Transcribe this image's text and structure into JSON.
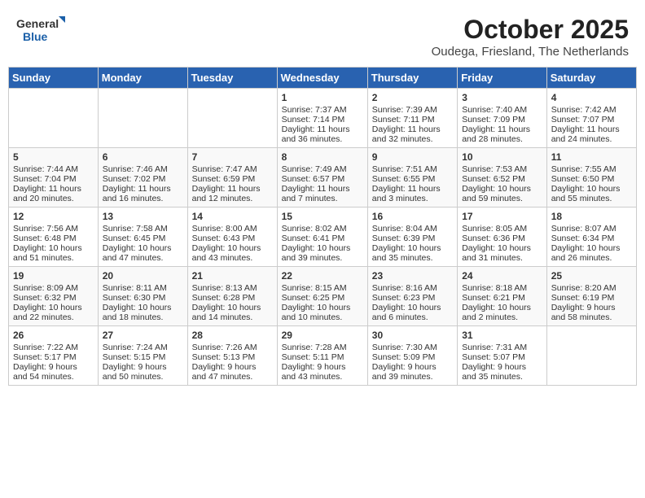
{
  "header": {
    "logo_general": "General",
    "logo_blue": "Blue",
    "title": "October 2025",
    "subtitle": "Oudega, Friesland, The Netherlands"
  },
  "weekdays": [
    "Sunday",
    "Monday",
    "Tuesday",
    "Wednesday",
    "Thursday",
    "Friday",
    "Saturday"
  ],
  "weeks": [
    [
      {
        "day": "",
        "lines": []
      },
      {
        "day": "",
        "lines": []
      },
      {
        "day": "",
        "lines": []
      },
      {
        "day": "1",
        "lines": [
          "Sunrise: 7:37 AM",
          "Sunset: 7:14 PM",
          "Daylight: 11 hours",
          "and 36 minutes."
        ]
      },
      {
        "day": "2",
        "lines": [
          "Sunrise: 7:39 AM",
          "Sunset: 7:11 PM",
          "Daylight: 11 hours",
          "and 32 minutes."
        ]
      },
      {
        "day": "3",
        "lines": [
          "Sunrise: 7:40 AM",
          "Sunset: 7:09 PM",
          "Daylight: 11 hours",
          "and 28 minutes."
        ]
      },
      {
        "day": "4",
        "lines": [
          "Sunrise: 7:42 AM",
          "Sunset: 7:07 PM",
          "Daylight: 11 hours",
          "and 24 minutes."
        ]
      }
    ],
    [
      {
        "day": "5",
        "lines": [
          "Sunrise: 7:44 AM",
          "Sunset: 7:04 PM",
          "Daylight: 11 hours",
          "and 20 minutes."
        ]
      },
      {
        "day": "6",
        "lines": [
          "Sunrise: 7:46 AM",
          "Sunset: 7:02 PM",
          "Daylight: 11 hours",
          "and 16 minutes."
        ]
      },
      {
        "day": "7",
        "lines": [
          "Sunrise: 7:47 AM",
          "Sunset: 6:59 PM",
          "Daylight: 11 hours",
          "and 12 minutes."
        ]
      },
      {
        "day": "8",
        "lines": [
          "Sunrise: 7:49 AM",
          "Sunset: 6:57 PM",
          "Daylight: 11 hours",
          "and 7 minutes."
        ]
      },
      {
        "day": "9",
        "lines": [
          "Sunrise: 7:51 AM",
          "Sunset: 6:55 PM",
          "Daylight: 11 hours",
          "and 3 minutes."
        ]
      },
      {
        "day": "10",
        "lines": [
          "Sunrise: 7:53 AM",
          "Sunset: 6:52 PM",
          "Daylight: 10 hours",
          "and 59 minutes."
        ]
      },
      {
        "day": "11",
        "lines": [
          "Sunrise: 7:55 AM",
          "Sunset: 6:50 PM",
          "Daylight: 10 hours",
          "and 55 minutes."
        ]
      }
    ],
    [
      {
        "day": "12",
        "lines": [
          "Sunrise: 7:56 AM",
          "Sunset: 6:48 PM",
          "Daylight: 10 hours",
          "and 51 minutes."
        ]
      },
      {
        "day": "13",
        "lines": [
          "Sunrise: 7:58 AM",
          "Sunset: 6:45 PM",
          "Daylight: 10 hours",
          "and 47 minutes."
        ]
      },
      {
        "day": "14",
        "lines": [
          "Sunrise: 8:00 AM",
          "Sunset: 6:43 PM",
          "Daylight: 10 hours",
          "and 43 minutes."
        ]
      },
      {
        "day": "15",
        "lines": [
          "Sunrise: 8:02 AM",
          "Sunset: 6:41 PM",
          "Daylight: 10 hours",
          "and 39 minutes."
        ]
      },
      {
        "day": "16",
        "lines": [
          "Sunrise: 8:04 AM",
          "Sunset: 6:39 PM",
          "Daylight: 10 hours",
          "and 35 minutes."
        ]
      },
      {
        "day": "17",
        "lines": [
          "Sunrise: 8:05 AM",
          "Sunset: 6:36 PM",
          "Daylight: 10 hours",
          "and 31 minutes."
        ]
      },
      {
        "day": "18",
        "lines": [
          "Sunrise: 8:07 AM",
          "Sunset: 6:34 PM",
          "Daylight: 10 hours",
          "and 26 minutes."
        ]
      }
    ],
    [
      {
        "day": "19",
        "lines": [
          "Sunrise: 8:09 AM",
          "Sunset: 6:32 PM",
          "Daylight: 10 hours",
          "and 22 minutes."
        ]
      },
      {
        "day": "20",
        "lines": [
          "Sunrise: 8:11 AM",
          "Sunset: 6:30 PM",
          "Daylight: 10 hours",
          "and 18 minutes."
        ]
      },
      {
        "day": "21",
        "lines": [
          "Sunrise: 8:13 AM",
          "Sunset: 6:28 PM",
          "Daylight: 10 hours",
          "and 14 minutes."
        ]
      },
      {
        "day": "22",
        "lines": [
          "Sunrise: 8:15 AM",
          "Sunset: 6:25 PM",
          "Daylight: 10 hours",
          "and 10 minutes."
        ]
      },
      {
        "day": "23",
        "lines": [
          "Sunrise: 8:16 AM",
          "Sunset: 6:23 PM",
          "Daylight: 10 hours",
          "and 6 minutes."
        ]
      },
      {
        "day": "24",
        "lines": [
          "Sunrise: 8:18 AM",
          "Sunset: 6:21 PM",
          "Daylight: 10 hours",
          "and 2 minutes."
        ]
      },
      {
        "day": "25",
        "lines": [
          "Sunrise: 8:20 AM",
          "Sunset: 6:19 PM",
          "Daylight: 9 hours",
          "and 58 minutes."
        ]
      }
    ],
    [
      {
        "day": "26",
        "lines": [
          "Sunrise: 7:22 AM",
          "Sunset: 5:17 PM",
          "Daylight: 9 hours",
          "and 54 minutes."
        ]
      },
      {
        "day": "27",
        "lines": [
          "Sunrise: 7:24 AM",
          "Sunset: 5:15 PM",
          "Daylight: 9 hours",
          "and 50 minutes."
        ]
      },
      {
        "day": "28",
        "lines": [
          "Sunrise: 7:26 AM",
          "Sunset: 5:13 PM",
          "Daylight: 9 hours",
          "and 47 minutes."
        ]
      },
      {
        "day": "29",
        "lines": [
          "Sunrise: 7:28 AM",
          "Sunset: 5:11 PM",
          "Daylight: 9 hours",
          "and 43 minutes."
        ]
      },
      {
        "day": "30",
        "lines": [
          "Sunrise: 7:30 AM",
          "Sunset: 5:09 PM",
          "Daylight: 9 hours",
          "and 39 minutes."
        ]
      },
      {
        "day": "31",
        "lines": [
          "Sunrise: 7:31 AM",
          "Sunset: 5:07 PM",
          "Daylight: 9 hours",
          "and 35 minutes."
        ]
      },
      {
        "day": "",
        "lines": []
      }
    ]
  ]
}
